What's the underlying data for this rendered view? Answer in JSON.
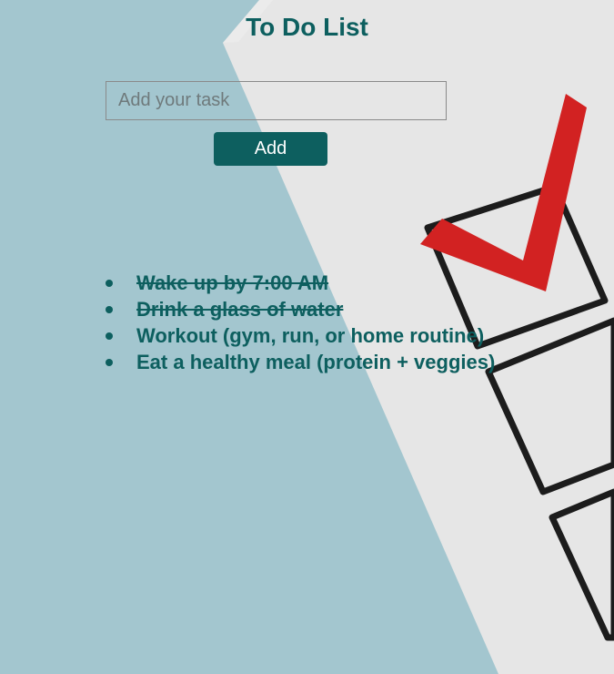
{
  "app": {
    "title": "To Do List"
  },
  "task_input": {
    "value": "",
    "placeholder": "Add your task"
  },
  "add_button": {
    "label": "Add"
  },
  "tasks": [
    {
      "text": "Wake up by 7:00 AM",
      "completed": true
    },
    {
      "text": "Drink a glass of water",
      "completed": true
    },
    {
      "text": "Workout (gym, run, or home routine)",
      "completed": false
    },
    {
      "text": "Eat a healthy meal (protein + veggies)",
      "completed": false
    }
  ],
  "background": {
    "image": "checklist-with-red-checkmark",
    "colors": {
      "backdrop": "#a3c6cf",
      "paper": "#e6e6e6",
      "checkmark": "#d22222",
      "box_outline": "#1c1c1c"
    }
  },
  "colors": {
    "accent": "#0d5f5f",
    "button_text": "#ffffff"
  }
}
